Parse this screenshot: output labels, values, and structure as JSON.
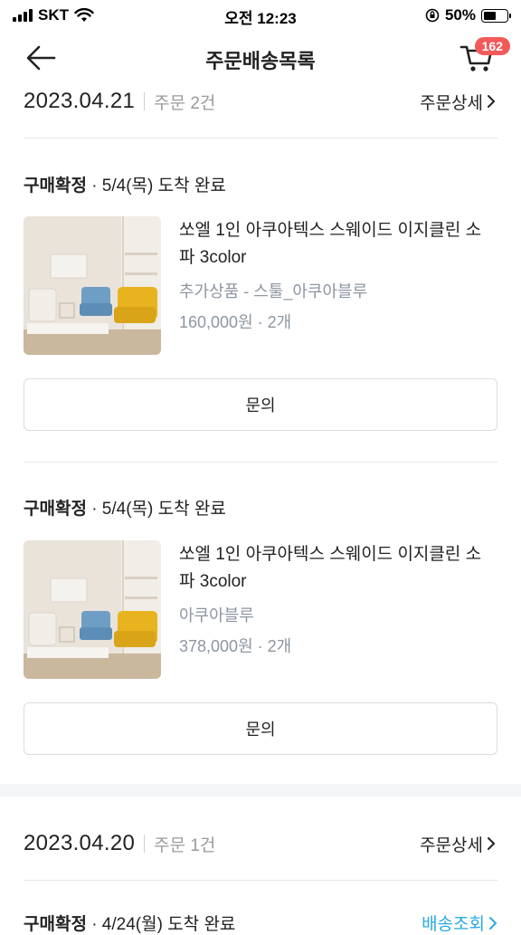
{
  "status_bar": {
    "carrier": "SKT",
    "time": "오전 12:23",
    "battery": "50%"
  },
  "header": {
    "title": "주문배송목록",
    "cart_badge": "162"
  },
  "orders": [
    {
      "date": "2023.04.21",
      "count": "주문 2건",
      "detail_label": "주문상세",
      "items": [
        {
          "status_label": "구매확정",
          "status_detail": " · 5/4(목) 도착 완료",
          "name": "쏘엘 1인 아쿠아텍스 스웨이드 이지클린 소파 3color",
          "option": "추가상품 - 스툴_아쿠아블루",
          "price": "160,000원 · 2개",
          "button": "문의"
        },
        {
          "status_label": "구매확정",
          "status_detail": " · 5/4(목) 도착 완료",
          "name": "쏘엘 1인 아쿠아텍스 스웨이드 이지클린 소파 3color",
          "option": "아쿠아블루",
          "price": "378,000원 · 2개",
          "button": "문의"
        }
      ]
    },
    {
      "date": "2023.04.20",
      "count": "주문 1건",
      "detail_label": "주문상세",
      "items": [
        {
          "status_label": "구매확정",
          "status_detail": " · 4/24(월) 도착 완료",
          "link": "배송조회"
        }
      ]
    }
  ],
  "colors": {
    "badge": "#f25a5a",
    "link": "#2aa9e0",
    "muted": "#8d96a0"
  },
  "icons": [
    "back-arrow-icon",
    "cart-icon",
    "chevron-right-icon",
    "wifi-icon",
    "signal-icon",
    "battery-icon",
    "orientation-lock-icon"
  ]
}
